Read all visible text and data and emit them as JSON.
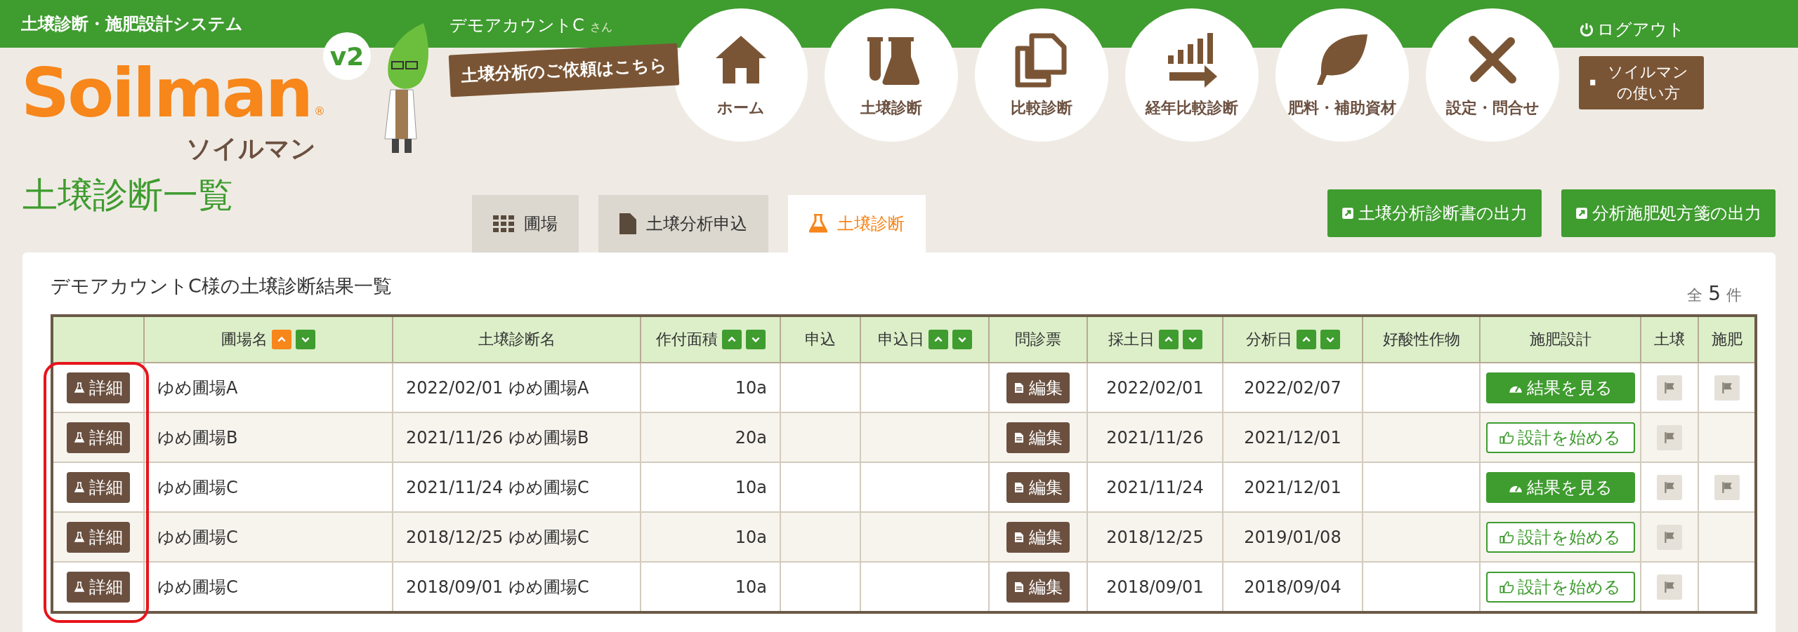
{
  "header": {
    "system_name": "土壌診断・施肥設計システム",
    "logo_text": "Soilman",
    "logo_registered": "®",
    "logo_kana": "ソイルマン",
    "version_badge": "v2",
    "account_name": "デモアカウントC",
    "account_suffix": "さん",
    "request_link": "土壌分析のご依頼はこちら",
    "logout": "ログアウト",
    "guide_button": "ソイルマンの使い方"
  },
  "nav": [
    {
      "label": "ホーム",
      "kind": "home"
    },
    {
      "label": "土壌診断",
      "kind": "soil"
    },
    {
      "label": "比較診断",
      "kind": "compare"
    },
    {
      "label": "経年比較診断",
      "kind": "trend"
    },
    {
      "label": "肥料・補助資材",
      "kind": "fertilizer"
    },
    {
      "label": "設定・問合せ",
      "kind": "settings"
    }
  ],
  "page_title": "土壌診断一覧",
  "tabs": [
    {
      "label": "圃場",
      "kind": "grid",
      "selected": false
    },
    {
      "label": "土壌分析申込",
      "kind": "doc",
      "selected": false
    },
    {
      "label": "土壌診断",
      "kind": "flask",
      "selected": true
    }
  ],
  "export_buttons": [
    "土壌分析診断書の出力",
    "分析施肥処方箋の出力"
  ],
  "card": {
    "title": "デモアカウントC様の土壌診断結果一覧",
    "total_prefix": "全",
    "total_count": "5",
    "total_suffix": "件"
  },
  "table": {
    "detail_column_highlighted": true,
    "columns": [
      {
        "label": "圃場名",
        "sortable": true,
        "sorted": true
      },
      {
        "label": "土壌診断名",
        "sortable": false
      },
      {
        "label": "作付面積",
        "sortable": true,
        "sorted": false
      },
      {
        "label": "申込",
        "sortable": false
      },
      {
        "label": "申込日",
        "sortable": true,
        "sorted": false
      },
      {
        "label": "問診票",
        "sortable": false
      },
      {
        "label": "採土日",
        "sortable": true,
        "sorted": false
      },
      {
        "label": "分析日",
        "sortable": true,
        "sorted": false
      },
      {
        "label": "好酸性作物",
        "sortable": false
      },
      {
        "label": "施肥設計",
        "sortable": false
      },
      {
        "label": "土壌",
        "sortable": false
      },
      {
        "label": "施肥",
        "sortable": false
      }
    ],
    "rows": [
      {
        "detail": "詳細",
        "field": "ゆめ圃場A",
        "name": "2022/02/01 ゆめ圃場A",
        "area": "10a",
        "edit": "編集",
        "sampled": "2022/02/01",
        "analyzed": "2022/02/07",
        "design": {
          "kind": "result",
          "label": "結果を見る"
        },
        "soil_flag": true,
        "fert_flag": true
      },
      {
        "detail": "詳細",
        "field": "ゆめ圃場B",
        "name": "2021/11/26 ゆめ圃場B",
        "area": "20a",
        "edit": "編集",
        "sampled": "2021/11/26",
        "analyzed": "2021/12/01",
        "design": {
          "kind": "start",
          "label": "設計を始める"
        },
        "soil_flag": true,
        "fert_flag": false
      },
      {
        "detail": "詳細",
        "field": "ゆめ圃場C",
        "name": "2021/11/24 ゆめ圃場C",
        "area": "10a",
        "edit": "編集",
        "sampled": "2021/11/24",
        "analyzed": "2021/12/01",
        "design": {
          "kind": "result",
          "label": "結果を見る"
        },
        "soil_flag": true,
        "fert_flag": true
      },
      {
        "detail": "詳細",
        "field": "ゆめ圃場C",
        "name": "2018/12/25 ゆめ圃場C",
        "area": "10a",
        "edit": "編集",
        "sampled": "2018/12/25",
        "analyzed": "2019/01/08",
        "design": {
          "kind": "start",
          "label": "設計を始める"
        },
        "soil_flag": true,
        "fert_flag": false
      },
      {
        "detail": "詳細",
        "field": "ゆめ圃場C",
        "name": "2018/09/01 ゆめ圃場C",
        "area": "10a",
        "edit": "編集",
        "sampled": "2018/09/01",
        "analyzed": "2018/09/04",
        "design": {
          "kind": "start",
          "label": "設計を始める"
        },
        "soil_flag": true,
        "fert_flag": false
      }
    ]
  }
}
